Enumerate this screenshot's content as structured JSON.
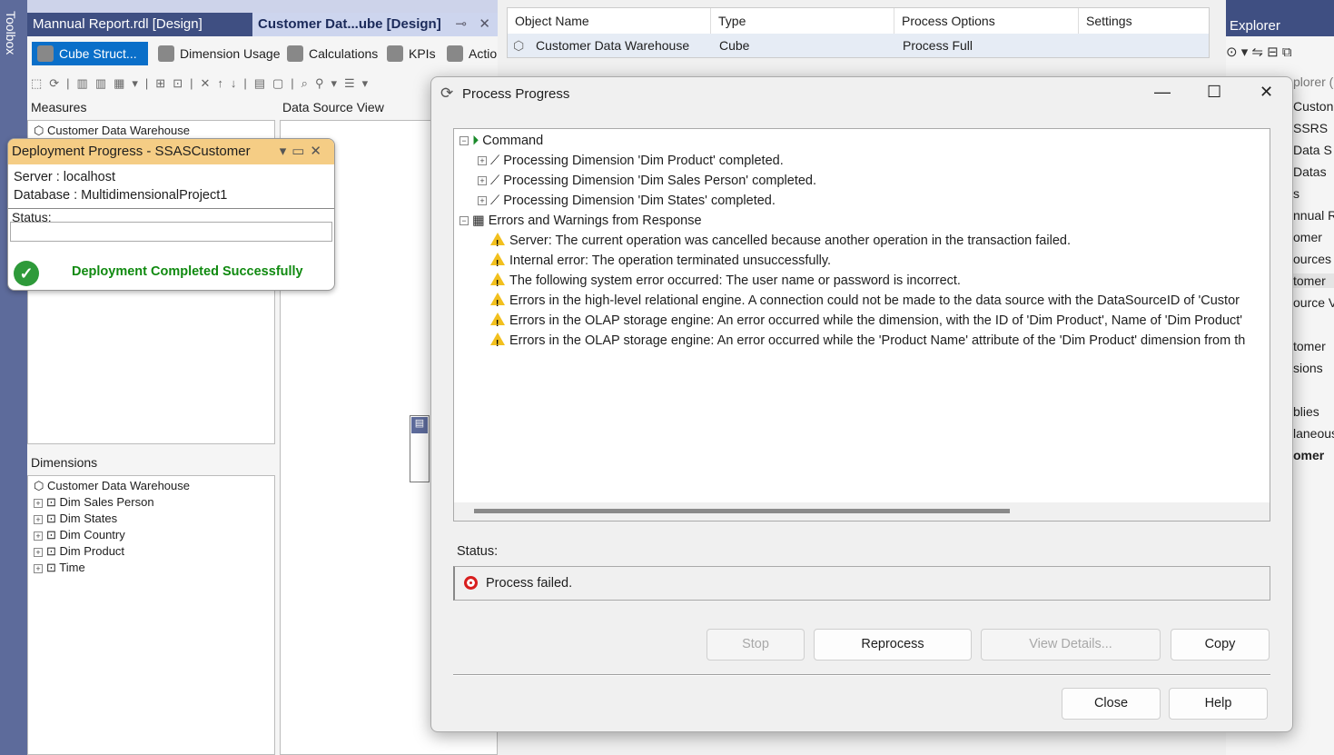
{
  "toolbox": {
    "label": "Toolbox"
  },
  "tabs": [
    {
      "label": "Mannual Report.rdl [Design]"
    },
    {
      "label": "Customer Dat...ube [Design]"
    }
  ],
  "designer": {
    "subtabs": [
      "Cube Struct...",
      "Dimension Usage",
      "Calculations",
      "KPIs",
      "Actions"
    ],
    "measures_header": "Measures",
    "measures_root": "Customer Data Warehouse",
    "dsv_header": "Data Source View",
    "dimensions_header": "Dimensions",
    "dimensions_root": "Customer Data Warehouse",
    "dimensions": [
      "Dim Sales Person",
      "Dim States",
      "Dim Country",
      "Dim Product",
      "Time"
    ]
  },
  "deployment": {
    "title": "Deployment Progress - SSASCustomer",
    "server": "Server :  localhost",
    "database": "Database : MultidimensionalProject1",
    "status_label": "Status:",
    "result": "Deployment Completed Successfully",
    "colors": {
      "header": "#f5cd85",
      "success": "#108a10"
    }
  },
  "object_list": {
    "columns": [
      "Object Name",
      "Type",
      "Process Options",
      "Settings"
    ],
    "rows": [
      {
        "name": "Customer Data Warehouse",
        "type": "Cube",
        "options": "Process Full",
        "settings": ""
      }
    ]
  },
  "solution_explorer": {
    "title": "Explorer",
    "items": [
      "plorer (",
      "Custon",
      "SSRS",
      "Data S",
      "Datas",
      "s",
      "nnual R",
      "omer",
      "ources",
      "tomer",
      "ource V",
      "tomer",
      "sions",
      "blies",
      "laneous",
      "omer"
    ]
  },
  "dialog": {
    "title": "Process Progress",
    "log": {
      "command": "Command",
      "dimensions": [
        "Processing Dimension 'Dim Product' completed.",
        "Processing Dimension 'Dim Sales Person' completed.",
        "Processing Dimension 'Dim States' completed."
      ],
      "errors_header": "Errors and Warnings from Response",
      "errors": [
        "Server: The current operation was cancelled because another operation in the transaction failed.",
        "Internal error: The operation terminated unsuccessfully.",
        "The following system error occurred:  The user name or password is incorrect.",
        "Errors in the high-level relational engine. A connection could not be made to the data source with the DataSourceID of 'Custor",
        "Errors in the OLAP storage engine: An error occurred while the dimension, with the ID of 'Dim Product', Name of 'Dim Product'",
        "Errors in the OLAP storage engine: An error occurred while the 'Product Name' attribute of the 'Dim Product' dimension from th"
      ]
    },
    "status_label": "Status:",
    "status": "Process failed.",
    "buttons": {
      "stop": "Stop",
      "reprocess": "Reprocess",
      "view_details": "View Details...",
      "copy": "Copy",
      "close": "Close",
      "help": "Help"
    }
  }
}
